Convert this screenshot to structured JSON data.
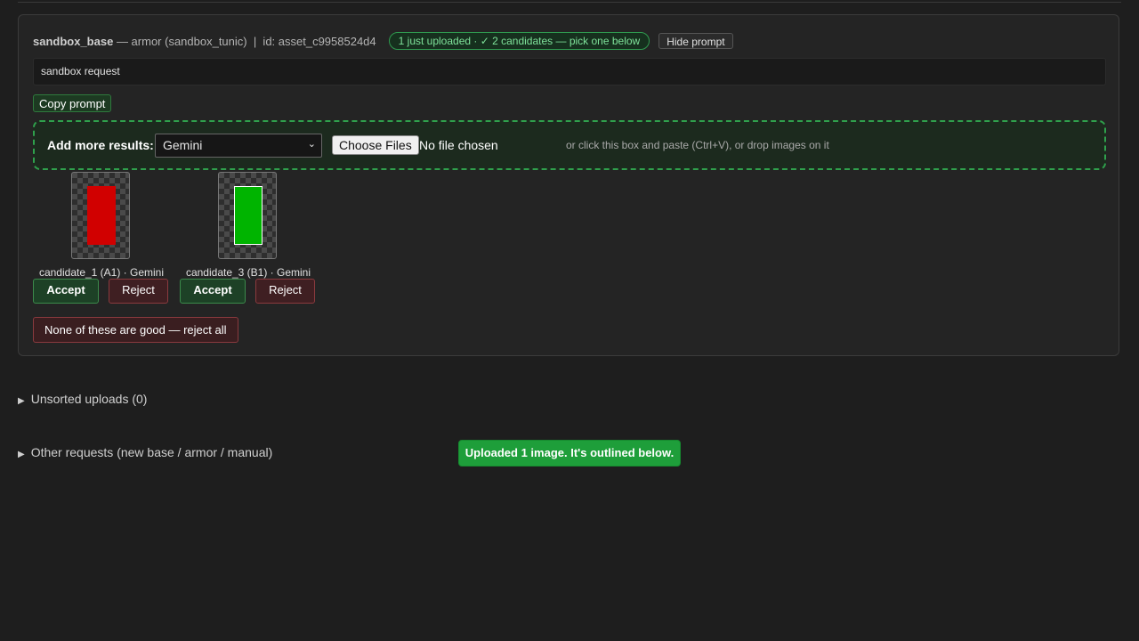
{
  "request": {
    "base": "sandbox_base",
    "descriptor": " — armor (sandbox_tunic)  |  id: asset_c9958524d4",
    "status_pill": "1 just uploaded · ✓ 2 candidates — pick one below",
    "hide_prompt_label": "Hide prompt",
    "prompt_text": "sandbox request",
    "copy_prompt_label": "Copy prompt"
  },
  "dropzone": {
    "label": "Add more results:",
    "model_selected": "Gemini",
    "choose_files_label": "Choose Files",
    "no_file_text": "No file chosen",
    "hint": "or click this box and paste (Ctrl+V), or drop images on it"
  },
  "candidates": [
    {
      "caption": "candidate_1 (A1) · Gemini",
      "swatch_color": "#d10000",
      "swatch_border": "#d10000",
      "accept_label": "Accept",
      "reject_label": "Reject"
    },
    {
      "caption": "candidate_3 (B1) · Gemini",
      "swatch_color": "#00b400",
      "swatch_border": "#ffffff",
      "accept_label": "Accept",
      "reject_label": "Reject"
    }
  ],
  "reject_all_label": "None of these are good — reject all",
  "sections": {
    "unsorted_label": "Unsorted uploads (0)",
    "other_label": "Other requests (new base / armor / manual)"
  },
  "toast_text": "Uploaded 1 image. It's outlined below.",
  "colors": {
    "accent_green": "#1e9e3a",
    "reject_red": "#3f1f22",
    "dashed_green": "#2fa04c"
  }
}
